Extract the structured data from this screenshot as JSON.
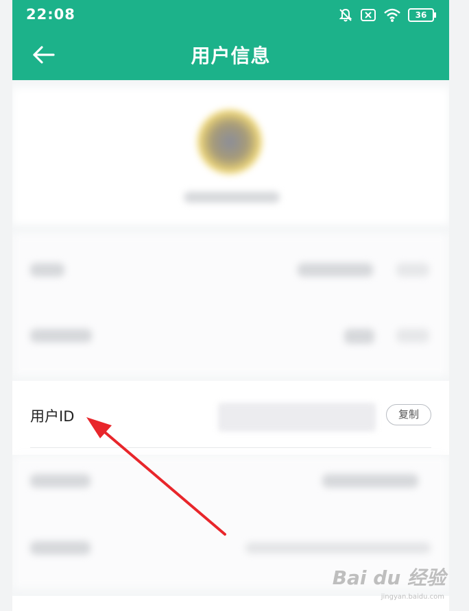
{
  "status_bar": {
    "time": "22:08",
    "battery": "36"
  },
  "header": {
    "title": "用户信息",
    "back_icon": "arrow-left-icon"
  },
  "user_id_row": {
    "label": "用户ID",
    "value": "",
    "copy_label": "复制"
  },
  "watermark": {
    "brand": "Bai du 经验",
    "url": "jingyan.baidu.com"
  },
  "colors": {
    "primary": "#1cb28a",
    "annotation_arrow": "#e8262b"
  }
}
